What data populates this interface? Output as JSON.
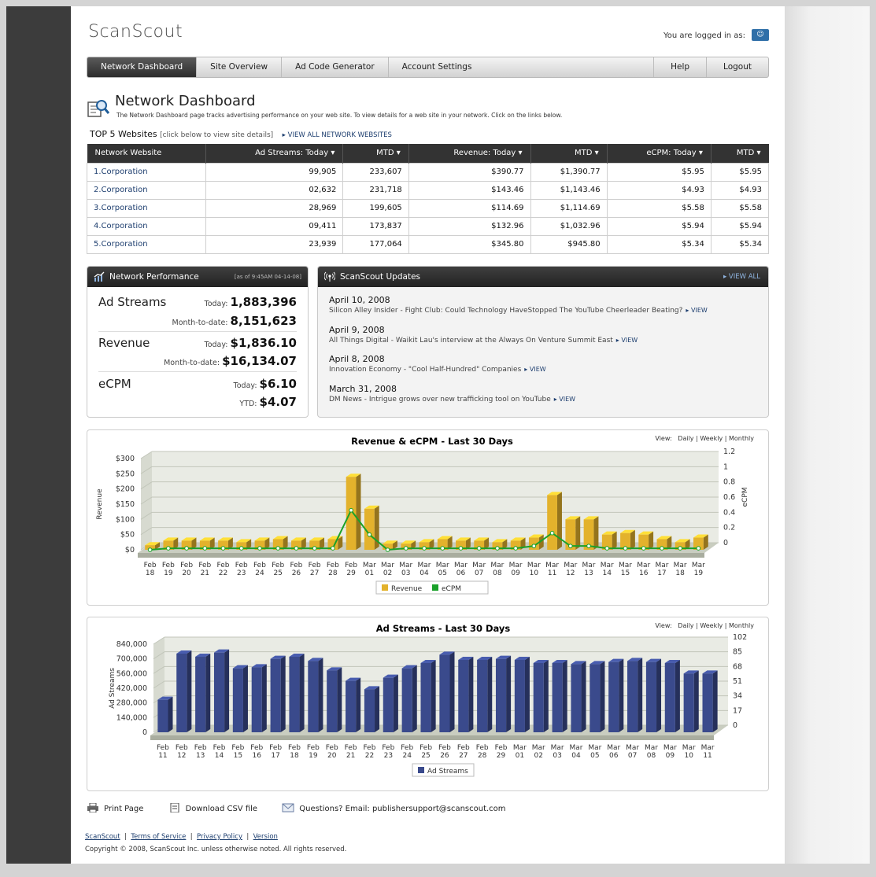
{
  "app": {
    "logo": "ScanScout",
    "login_text": "You are logged in as:"
  },
  "nav": {
    "items": [
      "Network Dashboard",
      "Site Overview",
      "Ad Code Generator",
      "Account Settings"
    ],
    "right_items": [
      "Help",
      "Logout"
    ],
    "active": "Network Dashboard"
  },
  "page": {
    "title": "Network Dashboard",
    "description": "The Network Dashboard page tracks advertising performance on your web site. To view details for a web site in your network. Click on the links below.",
    "top5_label": "TOP 5 Websites",
    "top5_hint": "[click below to view site details]",
    "view_all_sites": "▸ VIEW ALL NETWORK WEBSITES"
  },
  "sites_table": {
    "headers": [
      "Network Website",
      "Ad Streams: Today ▾",
      "MTD ▾",
      "Revenue: Today ▾",
      "MTD ▾",
      "eCPM: Today ▾",
      "MTD ▾"
    ],
    "rows": [
      [
        "1.Corporation",
        "99,905",
        "233,607",
        "$390.77",
        "$1,390.77",
        "$5.95",
        "$5.95"
      ],
      [
        "2.Corporation",
        "02,632",
        "231,718",
        "$143.46",
        "$1,143.46",
        "$4.93",
        "$4.93"
      ],
      [
        "3.Corporation",
        "28,969",
        "199,605",
        "$114.69",
        "$1,114.69",
        "$5.58",
        "$5.58"
      ],
      [
        "4.Corporation",
        "09,411",
        "173,837",
        "$132.96",
        "$1,032.96",
        "$5.94",
        "$5.94"
      ],
      [
        "5.Corporation",
        "23,939",
        "177,064",
        "$345.80",
        "$945.80",
        "$5.34",
        "$5.34"
      ]
    ]
  },
  "performance": {
    "title": "Network Performance",
    "as_of": "[as of 9:45AM 04-14-08]",
    "ad_streams_label": "Ad Streams",
    "ad_streams_today_label": "Today:",
    "ad_streams_today": "1,883,396",
    "ad_streams_mtd_label": "Month-to-date:",
    "ad_streams_mtd": "8,151,623",
    "revenue_label": "Revenue",
    "revenue_today_label": "Today:",
    "revenue_today": "$1,836.10",
    "revenue_mtd_label": "Month-to-date:",
    "revenue_mtd": "$16,134.07",
    "ecpm_label": "eCPM",
    "ecpm_today_label": "Today:",
    "ecpm_today": "$6.10",
    "ecpm_ytd_label": "YTD:",
    "ecpm_ytd": "$4.07"
  },
  "updates": {
    "title": "ScanScout Updates",
    "view_all": "▸ VIEW ALL",
    "items": [
      {
        "date": "April 10, 2008",
        "text": "Silicon Alley Insider - Fight Club: Could Technology HaveStopped The YouTube Cheerleader Beating?",
        "link": "▸ VIEW"
      },
      {
        "date": "April 9, 2008",
        "text": "All Things Digital - Waikit Lau's interview at the Always On Venture Summit East",
        "link": "▸ VIEW"
      },
      {
        "date": "April 8, 2008",
        "text": "Innovation Economy - \"Cool Half-Hundred\" Companies",
        "link": "▸ VIEW"
      },
      {
        "date": "March 31, 2008",
        "text": "DM News - Intrigue grows over new trafficking tool on YouTube",
        "link": "▸ VIEW"
      }
    ]
  },
  "view_selector": {
    "label": "View:",
    "options": [
      "Daily",
      "Weekly",
      "Monthly"
    ]
  },
  "chart_data": [
    {
      "type": "bar",
      "title": "Revenue & eCPM - Last 30 Days",
      "ylabel": "Revenue",
      "y2label": "eCPM",
      "ylim": [
        0,
        300
      ],
      "y2lim": [
        0,
        1.2
      ],
      "yticks": [
        "$0",
        "$50",
        "$100",
        "$150",
        "$200",
        "$250",
        "$300"
      ],
      "y2ticks": [
        "0",
        "0.2",
        "0.4",
        "0.6",
        "0.8",
        "1",
        "1.2"
      ],
      "categories": [
        "Feb 18",
        "Feb 19",
        "Feb 20",
        "Feb 21",
        "Feb 22",
        "Feb 23",
        "Feb 24",
        "Feb 25",
        "Feb 26",
        "Feb 27",
        "Feb 28",
        "Feb 29",
        "Mar 01",
        "Mar 02",
        "Mar 03",
        "Mar 04",
        "Mar 05",
        "Mar 06",
        "Mar 07",
        "Mar 08",
        "Mar 09",
        "Mar 10",
        "Mar 11",
        "Mar 12",
        "Mar 13",
        "Mar 14",
        "Mar 15",
        "Mar 16",
        "Mar 17",
        "Mar 18",
        "Mar 19"
      ],
      "series": [
        {
          "name": "Revenue",
          "kind": "bar",
          "color": "#e3b22c",
          "values": [
            15,
            30,
            30,
            30,
            30,
            25,
            30,
            35,
            30,
            30,
            35,
            240,
            135,
            20,
            20,
            25,
            35,
            30,
            30,
            25,
            30,
            40,
            180,
            100,
            100,
            50,
            55,
            50,
            35,
            25,
            40
          ]
        },
        {
          "name": "eCPM",
          "kind": "line",
          "color": "#1aa12a",
          "values": [
            0,
            0.02,
            0.02,
            0.02,
            0.02,
            0.02,
            0.02,
            0.02,
            0.02,
            0.02,
            0.02,
            0.52,
            0.2,
            0,
            0.02,
            0.02,
            0.02,
            0.02,
            0.02,
            0.02,
            0.02,
            0.05,
            0.22,
            0.05,
            0.05,
            0.02,
            0.02,
            0.02,
            0.02,
            0.02,
            0.02
          ]
        }
      ],
      "legend": [
        "Revenue",
        "eCPM"
      ],
      "legend_position": "bottom"
    },
    {
      "type": "bar",
      "title": "Ad Streams - Last 30 Days",
      "ylabel": "Ad Streams",
      "ylim": [
        0,
        840000
      ],
      "y2lim": [
        0,
        102
      ],
      "yticks": [
        "0",
        "140,000",
        "280,000",
        "420,000",
        "560,000",
        "700,000",
        "840,000"
      ],
      "y2ticks": [
        "0",
        "17",
        "34",
        "51",
        "68",
        "85",
        "102"
      ],
      "categories": [
        "Feb 11",
        "Feb 12",
        "Feb 13",
        "Feb 14",
        "Feb 15",
        "Feb 16",
        "Feb 17",
        "Feb 18",
        "Feb 19",
        "Feb 20",
        "Feb 21",
        "Feb 22",
        "Feb 23",
        "Feb 24",
        "Feb 25",
        "Feb 26",
        "Feb 27",
        "Feb 28",
        "Feb 29",
        "Mar 01",
        "Mar 02",
        "Mar 03",
        "Mar 04",
        "Mar 05",
        "Mar 06",
        "Mar 07",
        "Mar 08",
        "Mar 09",
        "Mar 10",
        "Mar 11"
      ],
      "series": [
        {
          "name": "Ad Streams",
          "kind": "bar",
          "color": "#3a4a8c",
          "values": [
            310000,
            750000,
            720000,
            760000,
            610000,
            620000,
            700000,
            720000,
            680000,
            590000,
            490000,
            410000,
            520000,
            610000,
            660000,
            740000,
            690000,
            690000,
            700000,
            690000,
            660000,
            660000,
            650000,
            650000,
            670000,
            680000,
            670000,
            660000,
            560000,
            560000
          ]
        }
      ],
      "legend": [
        "Ad Streams"
      ],
      "legend_position": "bottom"
    }
  ],
  "footer": {
    "print": "Print Page",
    "csv": "Download CSV file",
    "email": "Questions? Email: publishersupport@scanscout.com",
    "links": [
      "ScanScout",
      "Terms of Service",
      "Privacy Policy",
      "Version"
    ],
    "copyright": "Copyright © 2008, ScanScout Inc. unless otherwise noted. All rights reserved."
  },
  "colors": {
    "accent_link": "#1c3d6e",
    "revenue_bar": "#e3b22c",
    "ecpm_line": "#1aa12a",
    "streams_bar": "#3a4a8c",
    "header_dark": "#333333"
  }
}
